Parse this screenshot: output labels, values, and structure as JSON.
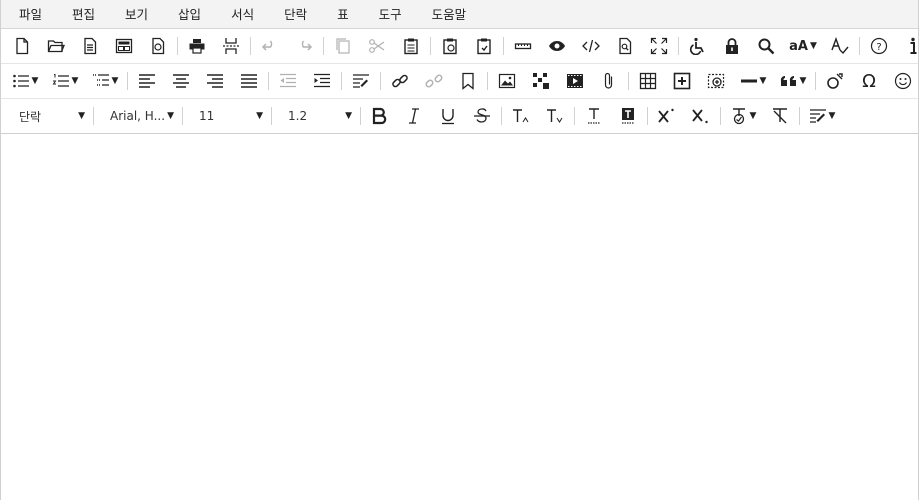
{
  "menubar": {
    "items": [
      "파일",
      "편집",
      "보기",
      "삽입",
      "서식",
      "단락",
      "표",
      "도구",
      "도움말"
    ]
  },
  "format_toolbar": {
    "paragraph_select": "단락",
    "font_select": "Arial, H...",
    "size_select": "11",
    "line_height_select": "1.2"
  },
  "icons": {
    "row1": [
      "new-document-icon",
      "open-icon",
      "template-icon",
      "layout-icon",
      "restore-icon",
      "print-icon",
      "page-break-icon",
      "undo-icon",
      "redo-icon",
      "copy-icon",
      "cut-icon",
      "paste-icon",
      "paste-text-icon",
      "paste-word-icon",
      "ruler-icon",
      "preview-icon",
      "code-icon",
      "find-icon",
      "fullscreen-icon",
      "accessibility-icon",
      "lock-icon",
      "search-icon",
      "font-size-icon",
      "spellcheck-icon",
      "help-icon",
      "info-icon"
    ],
    "row2": [
      "bullet-list-icon",
      "numbered-list-icon",
      "multilevel-list-icon",
      "align-left-icon",
      "align-center-icon",
      "align-right-icon",
      "align-justify-icon",
      "outdent-icon",
      "indent-icon",
      "format-block-icon",
      "link-icon",
      "unlink-icon",
      "bookmark-icon",
      "image-icon",
      "image-map-icon",
      "video-icon",
      "attachment-icon",
      "table-icon",
      "insert-row-icon",
      "insert-object-icon",
      "horizontal-rule-icon",
      "quote-icon",
      "special-char-icon",
      "omega-icon",
      "emoji-icon"
    ]
  },
  "colors": {
    "menubar_bg": "#f3f3f3",
    "border": "#d0d0d0",
    "icon": "#222222"
  }
}
